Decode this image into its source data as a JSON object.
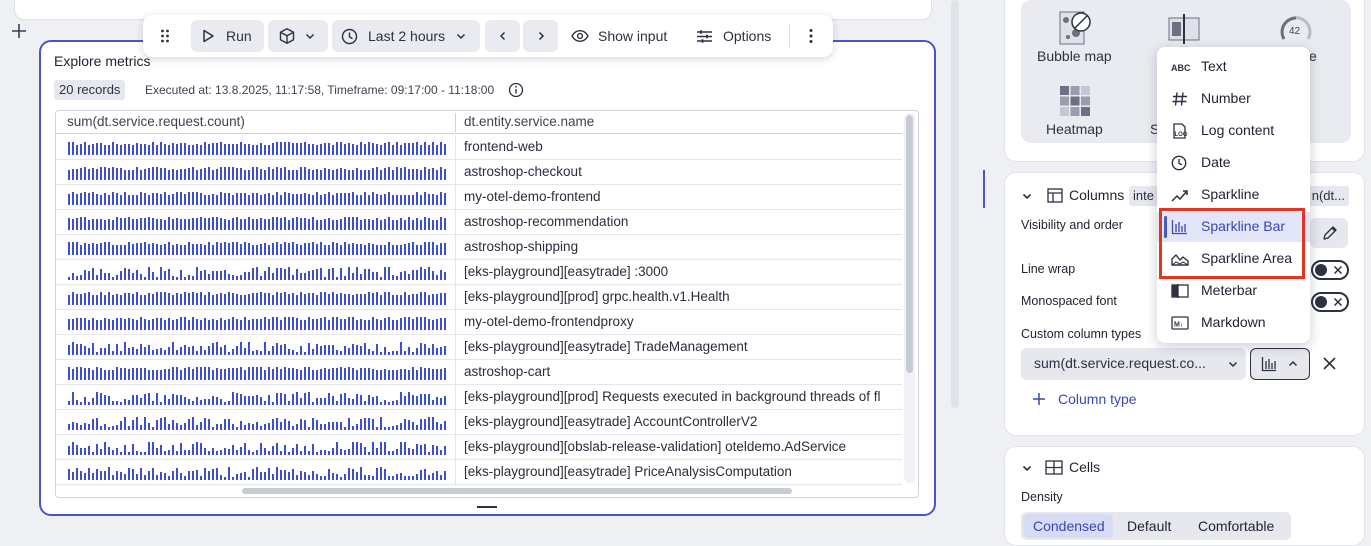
{
  "toolbar": {
    "run_label": "Run",
    "timeframe_label": "Last 2 hours",
    "show_input_label": "Show input",
    "options_label": "Options"
  },
  "tile": {
    "title": "Explore metrics",
    "records_badge": "20 records",
    "executed_text": "Executed at: 13.8.2025, 11:17:58, Timeframe: 09:17:00 - 11:18:00"
  },
  "table": {
    "columns": [
      "sum(dt.service.request.count)",
      "dt.entity.service.name"
    ],
    "rows": [
      {
        "service": "frontend-web"
      },
      {
        "service": "astroshop-checkout"
      },
      {
        "service": "my-otel-demo-frontend"
      },
      {
        "service": "astroshop-recommendation"
      },
      {
        "service": "astroshop-shipping"
      },
      {
        "service": "[eks-playground][easytrade] :3000"
      },
      {
        "service": "[eks-playground][prod] grpc.health.v1.Health"
      },
      {
        "service": "my-otel-demo-frontendproxy"
      },
      {
        "service": "[eks-playground][easytrade] TradeManagement"
      },
      {
        "service": "astroshop-cart"
      },
      {
        "service": "[eks-playground][prod] Requests executed in background threads of fl"
      },
      {
        "service": "[eks-playground][easytrade] AccountControllerV2"
      },
      {
        "service": "[eks-playground][obslab-release-validation] oteldemo.AdService"
      },
      {
        "service": "[eks-playground][easytrade] PriceAnalysisComputation"
      }
    ]
  },
  "viz_panel": {
    "items": [
      {
        "label": "Bubble map"
      },
      {
        "label": "Heatmap"
      },
      {
        "label": "S"
      },
      {
        "label": "e"
      }
    ],
    "gauge_value": "42"
  },
  "columns_section": {
    "title": "Columns",
    "chip_text": "inte",
    "chip_text_right": "n(dt...",
    "visibility_label": "Visibility and order",
    "line_wrap_label": "Line wrap",
    "monospaced_label": "Monospaced font",
    "custom_types_label": "Custom column types",
    "custom_column_value": "sum(dt.service.request.co...",
    "add_column_type_label": "Column type"
  },
  "cells_section": {
    "title": "Cells",
    "density_label": "Density",
    "density_options": [
      "Condensed",
      "Default",
      "Comfortable"
    ]
  },
  "type_menu": {
    "items": [
      {
        "label": "Text",
        "icon": "abc-icon"
      },
      {
        "label": "Number",
        "icon": "hash-icon"
      },
      {
        "label": "Log content",
        "icon": "log-icon"
      },
      {
        "label": "Date",
        "icon": "clock-icon"
      },
      {
        "label": "Sparkline",
        "icon": "sparkline-icon"
      },
      {
        "label": "Sparkline Bar",
        "icon": "sparkline-bar-icon",
        "selected": true
      },
      {
        "label": "Sparkline Area",
        "icon": "sparkline-area-icon"
      },
      {
        "label": "Meterbar",
        "icon": "meterbar-icon"
      },
      {
        "label": "Markdown",
        "icon": "markdown-icon"
      }
    ]
  },
  "colors": {
    "accent": "#4a55c8",
    "highlight": "#e3341f",
    "spark_bar": "#3f4fd1"
  }
}
